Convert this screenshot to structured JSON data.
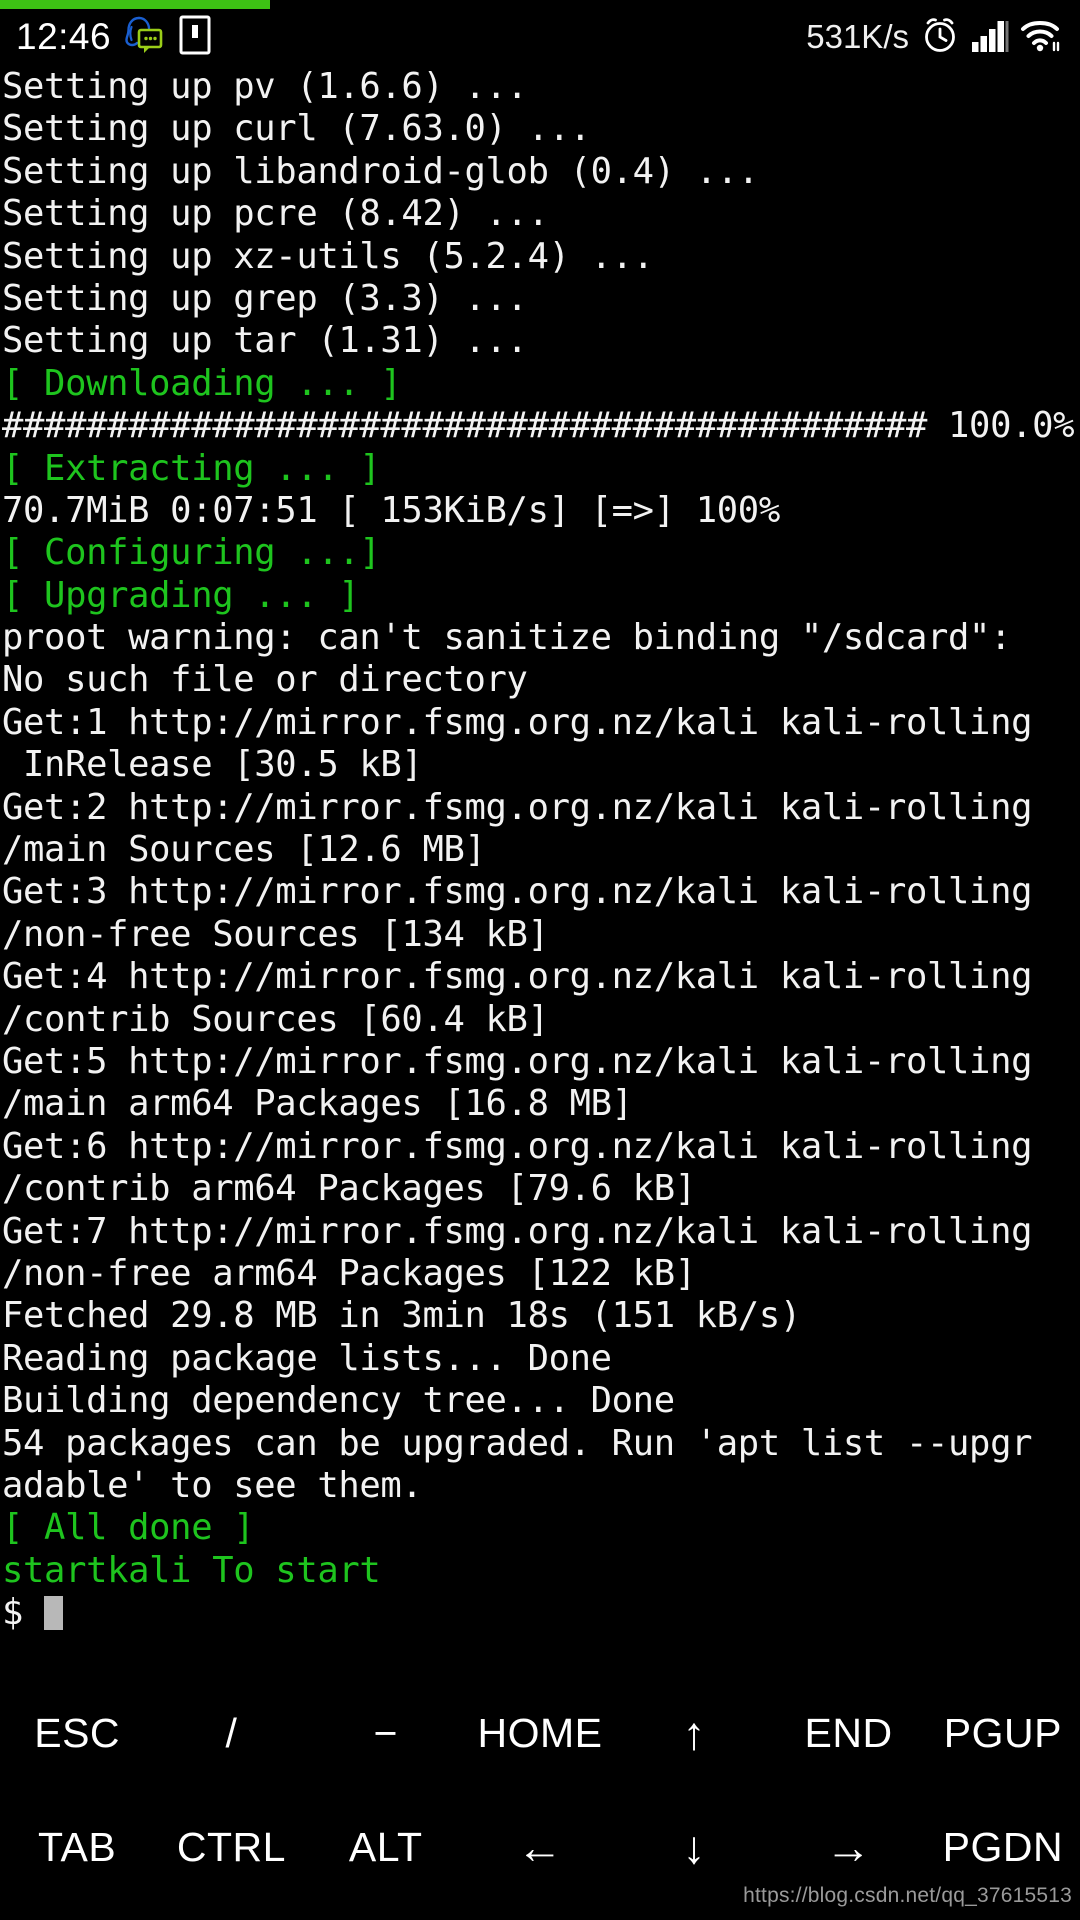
{
  "status_bar": {
    "clock": "12:46",
    "network_speed": "531K/s",
    "left_icons": [
      "qq-messenger-icon",
      "notification-card-icon"
    ],
    "right_icons": [
      "alarm-clock-icon",
      "signal-bars-icon",
      "wifi-icon"
    ]
  },
  "download_progress": {
    "percent": 25,
    "color": "#3dc214"
  },
  "terminal": {
    "colors": {
      "background": "#000000",
      "foreground": "#f2f2f2",
      "green": "#1ec41e",
      "cursor": "#b8b8b8"
    },
    "lines": [
      {
        "text": "Setting up pv (1.6.6) ...",
        "color": "white"
      },
      {
        "text": "Setting up curl (7.63.0) ...",
        "color": "white"
      },
      {
        "text": "Setting up libandroid-glob (0.4) ...",
        "color": "white"
      },
      {
        "text": "Setting up pcre (8.42) ...",
        "color": "white"
      },
      {
        "text": "Setting up xz-utils (5.2.4) ...",
        "color": "white"
      },
      {
        "text": "Setting up grep (3.3) ...",
        "color": "white"
      },
      {
        "text": "Setting up tar (1.31) ...",
        "color": "white"
      },
      {
        "text": "[ Downloading ... ]",
        "color": "green"
      },
      {
        "text": "############################################ 100.0%",
        "color": "white"
      },
      {
        "text": "[ Extracting ... ]",
        "color": "green"
      },
      {
        "text": "70.7MiB 0:07:51 [ 153KiB/s] [=>] 100%",
        "color": "white"
      },
      {
        "text": "[ Configuring ...]",
        "color": "green"
      },
      {
        "text": "[ Upgrading ... ]",
        "color": "green"
      },
      {
        "text": "proot warning: can't sanitize binding \"/sdcard\":",
        "color": "white"
      },
      {
        "text": "No such file or directory",
        "color": "white"
      },
      {
        "text": "Get:1 http://mirror.fsmg.org.nz/kali kali-rolling",
        "color": "white"
      },
      {
        "text": " InRelease [30.5 kB]",
        "color": "white"
      },
      {
        "text": "Get:2 http://mirror.fsmg.org.nz/kali kali-rolling",
        "color": "white"
      },
      {
        "text": "/main Sources [12.6 MB]",
        "color": "white"
      },
      {
        "text": "Get:3 http://mirror.fsmg.org.nz/kali kali-rolling",
        "color": "white"
      },
      {
        "text": "/non-free Sources [134 kB]",
        "color": "white"
      },
      {
        "text": "Get:4 http://mirror.fsmg.org.nz/kali kali-rolling",
        "color": "white"
      },
      {
        "text": "/contrib Sources [60.4 kB]",
        "color": "white"
      },
      {
        "text": "Get:5 http://mirror.fsmg.org.nz/kali kali-rolling",
        "color": "white"
      },
      {
        "text": "/main arm64 Packages [16.8 MB]",
        "color": "white"
      },
      {
        "text": "Get:6 http://mirror.fsmg.org.nz/kali kali-rolling",
        "color": "white"
      },
      {
        "text": "/contrib arm64 Packages [79.6 kB]",
        "color": "white"
      },
      {
        "text": "Get:7 http://mirror.fsmg.org.nz/kali kali-rolling",
        "color": "white"
      },
      {
        "text": "/non-free arm64 Packages [122 kB]",
        "color": "white"
      },
      {
        "text": "Fetched 29.8 MB in 3min 18s (151 kB/s)",
        "color": "white"
      },
      {
        "text": "Reading package lists... Done",
        "color": "white"
      },
      {
        "text": "Building dependency tree... Done",
        "color": "white"
      },
      {
        "text": "54 packages can be upgraded. Run 'apt list --upgr",
        "color": "white"
      },
      {
        "text": "adable' to see them.",
        "color": "white"
      },
      {
        "text": "[ All done ]",
        "color": "green"
      },
      {
        "text": "startkali To start",
        "color": "green"
      }
    ],
    "prompt": "$ "
  },
  "keybar": {
    "row1": [
      {
        "label": "ESC",
        "name": "key-esc",
        "glyph": false
      },
      {
        "label": "/",
        "name": "key-slash",
        "glyph": false
      },
      {
        "label": "−",
        "name": "key-minus",
        "glyph": false
      },
      {
        "label": "HOME",
        "name": "key-home",
        "glyph": false
      },
      {
        "label": "↑",
        "name": "key-arrow-up",
        "glyph": true
      },
      {
        "label": "END",
        "name": "key-end",
        "glyph": false
      },
      {
        "label": "PGUP",
        "name": "key-pgup",
        "glyph": false
      }
    ],
    "row2": [
      {
        "label": "TAB",
        "name": "key-tab",
        "glyph": false
      },
      {
        "label": "CTRL",
        "name": "key-ctrl",
        "glyph": false
      },
      {
        "label": "ALT",
        "name": "key-alt",
        "glyph": false
      },
      {
        "label": "←",
        "name": "key-arrow-left",
        "glyph": true
      },
      {
        "label": "↓",
        "name": "key-arrow-down",
        "glyph": true
      },
      {
        "label": "→",
        "name": "key-arrow-right",
        "glyph": true
      },
      {
        "label": "PGDN",
        "name": "key-pgdn",
        "glyph": false
      }
    ]
  },
  "watermark": "https://blog.csdn.net/qq_37615513"
}
